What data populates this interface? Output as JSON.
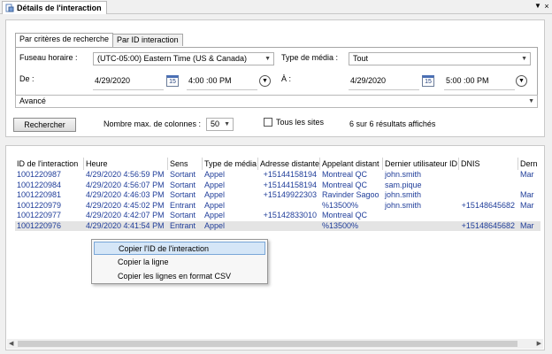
{
  "window": {
    "title": "Détails de l'interaction",
    "dropdown_icon": "dropdown-arrow-icon",
    "close_icon": "close-icon"
  },
  "tabs": [
    {
      "label": "Par critères de recherche",
      "active": true
    },
    {
      "label": "Par ID interaction",
      "active": false
    }
  ],
  "criteria": {
    "timezone_label": "Fuseau horaire :",
    "timezone_value": "(UTC-05:00) Eastern Time (US & Canada)",
    "media_label": "Type de média :",
    "media_value": "Tout",
    "from_label": "De :",
    "from_date": "4/29/2020",
    "from_time": "4:00 :00 PM",
    "to_label": "À :",
    "to_date": "4/29/2020",
    "to_time": "5:00 :00 PM",
    "calendar_glyph": "15",
    "advanced_label": "Avancé"
  },
  "actions": {
    "search_label": "Rechercher",
    "max_cols_label": "Nombre max. de colonnes :",
    "max_cols_value": "50",
    "all_sites_label": "Tous les sites",
    "results_summary": "6 sur 6 résultats affichés"
  },
  "grid": {
    "columns": [
      "ID de l'interaction",
      "Heure",
      "Sens",
      "Type de média",
      "Adresse distante",
      "Appelant distant",
      "Dernier utilisateur ID",
      "DNIS",
      "Dern"
    ],
    "rows": [
      [
        "1001220987",
        "4/29/2020 4:56:59 PM",
        "Sortant",
        "Appel",
        "+15144158194",
        "Montreal QC",
        "john.smith",
        "",
        "Mar"
      ],
      [
        "1001220984",
        "4/29/2020 4:56:07 PM",
        "Sortant",
        "Appel",
        "+15144158194",
        "Montreal QC",
        "sam.pique",
        "",
        ""
      ],
      [
        "1001220981",
        "4/29/2020 4:46:03 PM",
        "Sortant",
        "Appel",
        "+15149922303",
        "Ravinder Sagoo",
        "john.smith",
        "",
        "Mar"
      ],
      [
        "1001220979",
        "4/29/2020 4:45:02 PM",
        "Entrant",
        "Appel",
        "",
        "%13500%",
        "john.smith",
        "+15148645682",
        "Mar"
      ],
      [
        "1001220977",
        "4/29/2020 4:42:07 PM",
        "Sortant",
        "Appel",
        "+15142833010",
        "Montreal QC",
        "",
        "",
        ""
      ],
      [
        "1001220976",
        "4/29/2020 4:41:54 PM",
        "Entrant",
        "Appel",
        "",
        "%13500%",
        "",
        "+15148645682",
        "Mar"
      ]
    ]
  },
  "context_menu": [
    {
      "label": "Copier l'ID de l'interaction",
      "hover": true
    },
    {
      "label": "Copier la ligne",
      "hover": false
    },
    {
      "label": "Copier les lignes en format CSV",
      "hover": false
    }
  ]
}
